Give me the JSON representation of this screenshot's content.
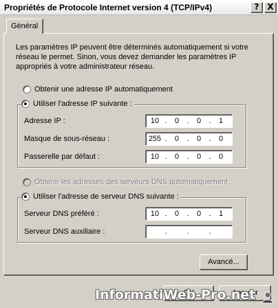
{
  "window": {
    "title": "Propriétés de Protocole Internet version 4 (TCP/IPv4)",
    "help_button": "?",
    "close_button": "X"
  },
  "tabs": [
    {
      "label": "Général",
      "selected": true
    }
  ],
  "description": "Les paramètres IP peuvent être déterminés automatiquement si votre réseau le permet. Sinon, vous devez demander les paramètres IP appropriés à votre administrateur réseau.",
  "ip": {
    "auto_option": "Obtenir une adresse IP automatiquement",
    "manual_option": "Utiliser l'adresse IP suivante :",
    "selected": "manual",
    "fields": [
      {
        "label": "Adresse IP :",
        "octets": [
          "10",
          "0",
          "0",
          "1"
        ]
      },
      {
        "label": "Masque de sous-réseau :",
        "octets": [
          "255",
          "0",
          "0",
          "0"
        ]
      },
      {
        "label": "Passerelle par défaut :",
        "octets": [
          "10",
          "0",
          "0",
          "0"
        ]
      }
    ]
  },
  "dns": {
    "auto_option": "Obtenir les adresses des serveurs DNS automatiquement",
    "auto_disabled": true,
    "manual_option": "Utiliser l'adresse de serveur DNS suivante :",
    "selected": "manual",
    "fields": [
      {
        "label": "Serveur DNS préféré :",
        "octets": [
          "10",
          "0",
          "0",
          "1"
        ]
      },
      {
        "label": "Serveur DNS auxiliaire :",
        "octets": [
          "",
          "",
          "",
          ""
        ]
      }
    ]
  },
  "buttons": {
    "advanced": "Avancé...",
    "ok": "OK",
    "cancel": "Annuler"
  },
  "watermark": "InformatiWeb-Pro.net",
  "icons": {
    "user": "user-icon"
  }
}
